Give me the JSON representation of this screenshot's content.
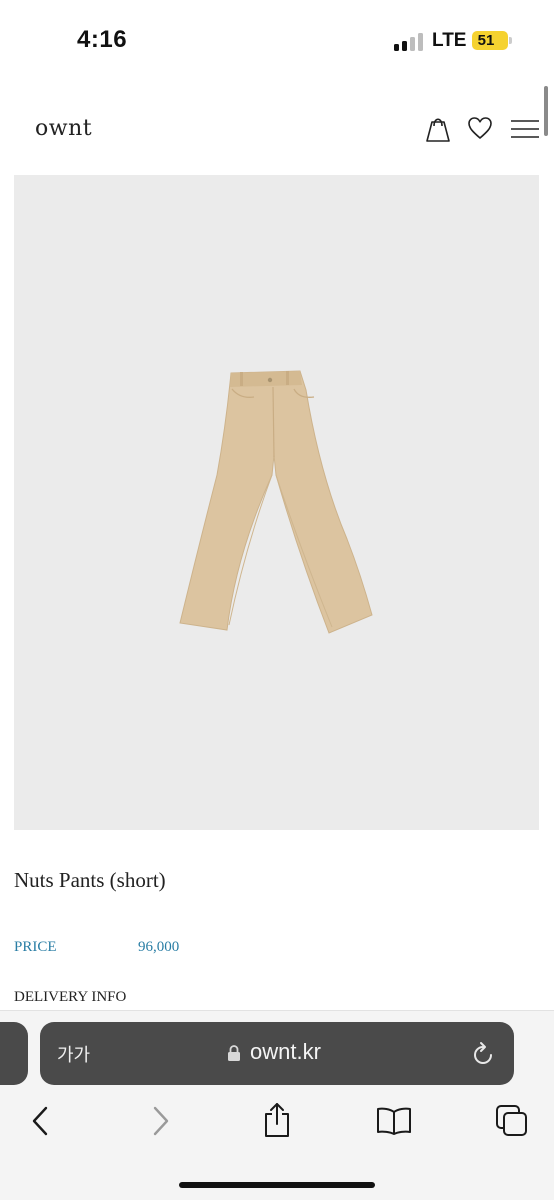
{
  "status_bar": {
    "time": "4:16",
    "network": "LTE",
    "battery": "51",
    "signal_bars_filled": 2,
    "signal_bars_total": 4
  },
  "header": {
    "logo": "ownt",
    "icons": [
      "shopping-bag-icon",
      "heart-icon",
      "menu-icon"
    ]
  },
  "product": {
    "image_alt_icon": "pants-image",
    "name": "Nuts Pants (short)",
    "price_label": "PRICE",
    "price_value": "96,000",
    "delivery_label": "DELIVERY INFO"
  },
  "browser": {
    "text_size_label": "가가",
    "url": "ownt.kr",
    "toolbar": [
      "back-icon",
      "forward-icon",
      "share-icon",
      "bookmarks-icon",
      "tabs-icon"
    ]
  },
  "colors": {
    "price_accent": "#2a7ea5",
    "battery": "#f5d230",
    "address_bar": "#4a4a4a",
    "image_bg": "#ebebeb",
    "pants": "#dcc4a0"
  }
}
